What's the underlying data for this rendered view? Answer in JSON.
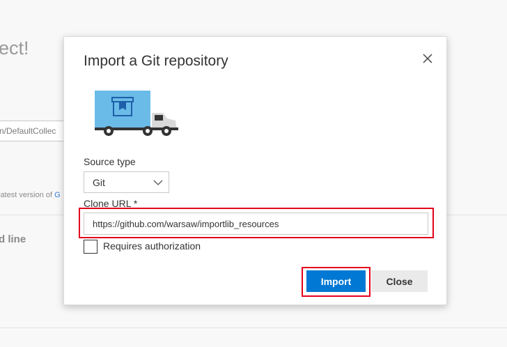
{
  "background": {
    "heading_partial": "ect!",
    "collection_field_value": "n/DefaultCollec",
    "hint_text": "latest version of ",
    "hint_link": "G",
    "subheading_partial": "d line"
  },
  "dialog": {
    "title": "Import a Git repository",
    "close_icon": "close-icon",
    "illustration": "truck-icon",
    "source_type": {
      "label": "Source type",
      "selected": "Git",
      "options": [
        "Git"
      ]
    },
    "clone_url": {
      "label": "Clone URL *",
      "value": "https://github.com/warsaw/importlib_resources",
      "placeholder": ""
    },
    "requires_auth": {
      "label": "Requires authorization",
      "checked": false
    },
    "buttons": {
      "import": "Import",
      "close": "Close"
    }
  },
  "colors": {
    "accent": "#0078d4",
    "highlight": "#e3001b",
    "truck_body": "#6bbbe8",
    "truck_cab": "#d9d9d9"
  }
}
